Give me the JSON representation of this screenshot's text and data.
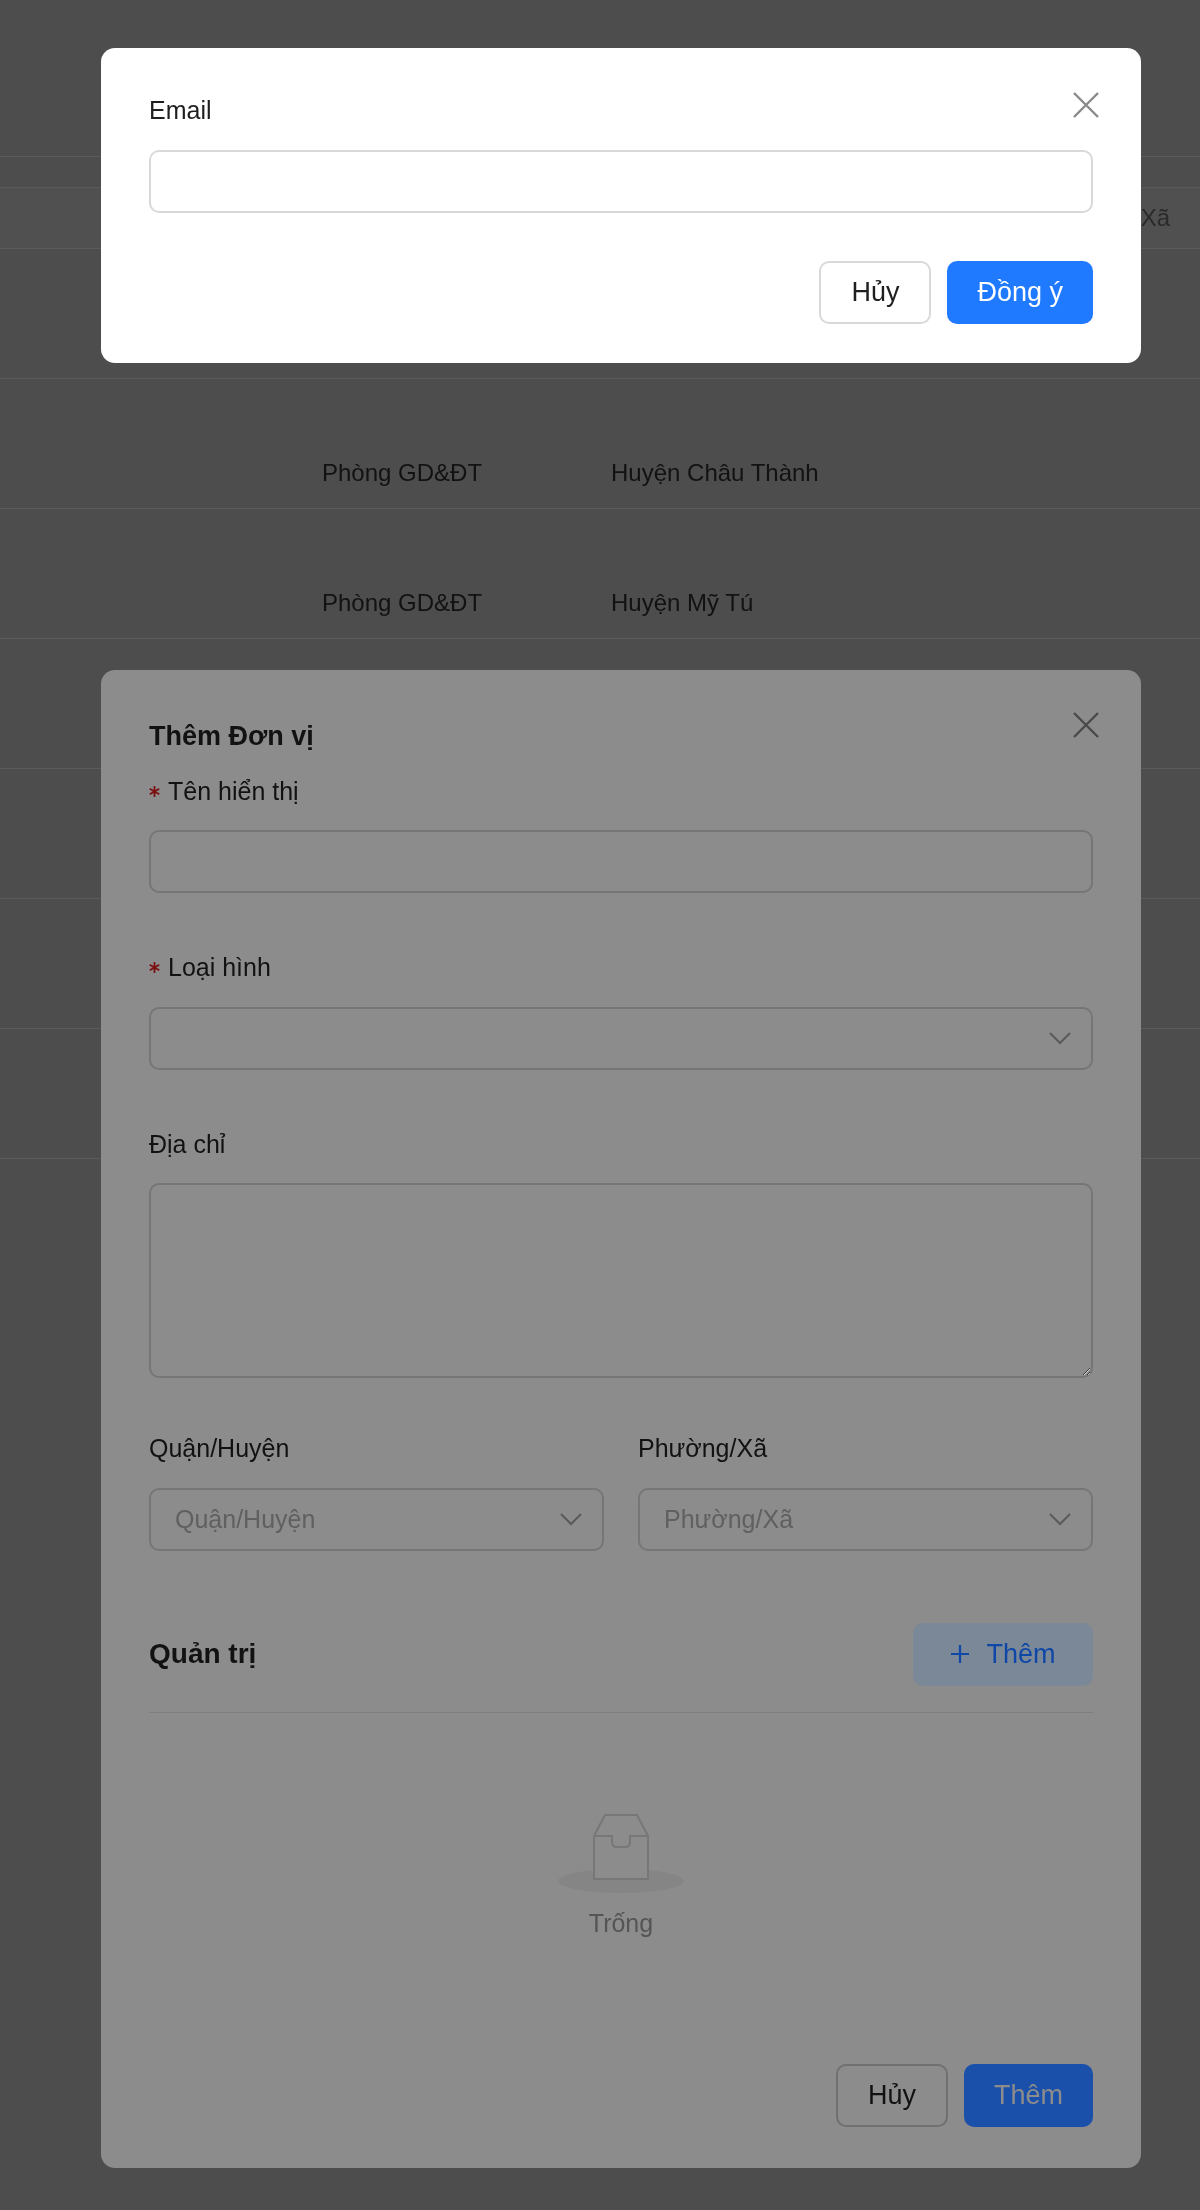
{
  "background_table": {
    "header": {
      "column_3": "Xã"
    },
    "rows": [
      {
        "column_1": "Phòng GD&ĐT",
        "column_2": "Huyện Châu Thành"
      },
      {
        "column_1": "Phòng GD&ĐT",
        "column_2": "Huyện Mỹ Tú"
      }
    ]
  },
  "email_dialog": {
    "label": "Email",
    "buttons": [
      {
        "label": "Hủy",
        "kind": "default"
      },
      {
        "label": "Đồng ý",
        "kind": "primary"
      }
    ]
  },
  "unit_dialog": {
    "title": "Thêm Đơn vị",
    "fields": [
      {
        "label": "Tên hiển thị",
        "required": true,
        "kind": "input"
      },
      {
        "label": "Loại hình",
        "required": true,
        "kind": "select"
      },
      {
        "label": "Địa chỉ",
        "required": false,
        "kind": "textarea"
      }
    ],
    "location_fields": [
      {
        "label": "Quận/Huyện",
        "placeholder": "Quận/Huyện"
      },
      {
        "label": "Phường/Xã",
        "placeholder": "Phường/Xã"
      }
    ],
    "admin_section": {
      "title": "Quản trị",
      "add_button": "Thêm",
      "empty_text": "Trống"
    },
    "buttons": [
      {
        "label": "Hủy",
        "kind": "default"
      },
      {
        "label": "Thêm",
        "kind": "primary"
      }
    ]
  }
}
